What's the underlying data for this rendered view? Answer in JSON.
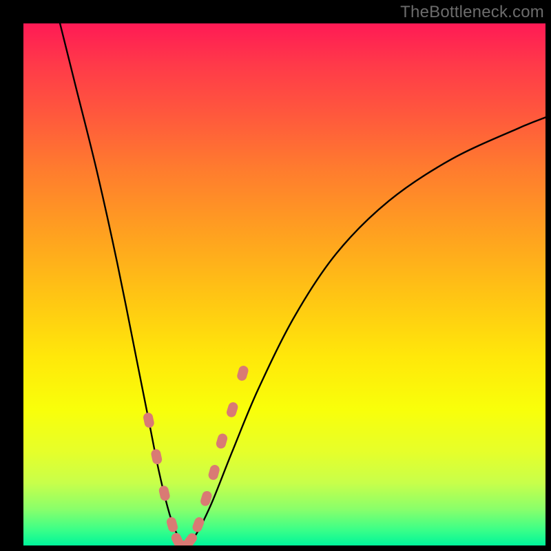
{
  "watermark": "TheBottleneck.com",
  "chart_data": {
    "type": "line",
    "title": "",
    "xlabel": "",
    "ylabel": "",
    "xlim": [
      0,
      100
    ],
    "ylim": [
      0,
      100
    ],
    "series": [
      {
        "name": "bottleneck-curve",
        "x": [
          7,
          10,
          14,
          18,
          22,
          24,
          26,
          28,
          29.5,
          31,
          33,
          36,
          40,
          45,
          52,
          60,
          70,
          82,
          95,
          100
        ],
        "values": [
          100,
          88,
          72,
          54,
          34,
          24,
          14,
          6,
          2,
          0,
          2,
          8,
          18,
          30,
          44,
          56,
          66,
          74,
          80,
          82
        ]
      }
    ],
    "highlight_points": {
      "name": "bottleneck-markers",
      "x": [
        24,
        25.5,
        27,
        28.5,
        29.5,
        30.5,
        32,
        33.5,
        35,
        36.5,
        38,
        40,
        42
      ],
      "values": [
        24,
        17,
        10,
        4,
        1,
        0,
        1,
        4,
        9,
        14,
        20,
        26,
        33
      ]
    },
    "gradient_colors": {
      "top": "#ff1a55",
      "upper_mid": "#ffa020",
      "mid": "#ffe80a",
      "lower_mid": "#c8ff4a",
      "bottom": "#00f59a"
    },
    "marker_color": "#d97a74"
  }
}
